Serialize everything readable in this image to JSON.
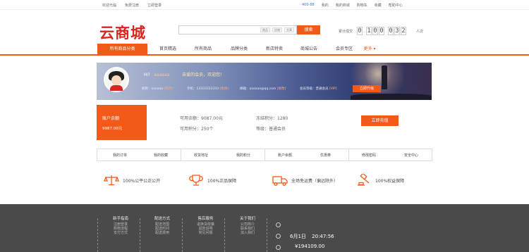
{
  "topbar": {
    "left": [
      "欢迎光临",
      "免费注册",
      "立即登录"
    ],
    "right": [
      "400-88",
      "我的",
      "我的商城",
      "购物车",
      "收藏",
      "帮助中心"
    ]
  },
  "logo": "云商城",
  "search": {
    "tags": [
      "商品",
      "店铺",
      "文章"
    ],
    "button": "搜索"
  },
  "counter": {
    "label": "累计成交",
    "digits": [
      "0",
      "1",
      "0",
      "0",
      "0",
      "3",
      "2"
    ],
    "unit": "人次"
  },
  "nav": {
    "tabs": [
      "所有商品分类",
      "首页精选",
      "所有商品",
      "品牌分类",
      "新店特卖",
      "商城公告",
      "会员专区",
      "更多"
    ],
    "active_index": 0
  },
  "banner": {
    "greeting": "Hi！",
    "username": "aaaaaa",
    "tip": "亲爱的会员，欢迎您！",
    "info": [
      {
        "label": "昵称：",
        "value": "aaaaaa",
        "verify": "[修改]"
      },
      {
        "label": "手机：",
        "value": "13333333333",
        "verify": "[修改]"
      },
      {
        "label": "邮箱：",
        "value": "aaaaaa@qq.com",
        "verify": "[修改]"
      },
      {
        "label": "会员等级：",
        "value": "普通会员",
        "verify": "[VIP]"
      }
    ],
    "vip_button": "立即升级"
  },
  "account": {
    "title": "账户余额",
    "value": "9987.00元",
    "available_balance": "可用余额：9087.00元",
    "available_points": "可用积分：250个",
    "frozen_points": "冻结积分：1280",
    "level": "等级：普通会员",
    "recharge_button": "立即充值"
  },
  "links": [
    [
      "我的订单",
      "我的收藏"
    ],
    [
      "收货地址",
      "我的积分"
    ],
    [
      "账户余额",
      "优惠券"
    ],
    [
      "修改密码",
      "安全中心"
    ]
  ],
  "guarantees": [
    {
      "icon": "scale-icon",
      "text": "100%公平公正公开"
    },
    {
      "icon": "trophy-icon",
      "text": "100%正品保障"
    },
    {
      "icon": "truck-icon",
      "text": "全场免运费（偏远除外）"
    },
    {
      "icon": "gavel-icon",
      "text": "100%权益保障"
    }
  ],
  "footer": {
    "columns": [
      {
        "title": "新手指南",
        "items": [
          "注册登录",
          "购物流程",
          "支付方式"
        ]
      },
      {
        "title": "配送方式",
        "items": [
          "配送范围",
          "配送时间",
          "配送费用"
        ]
      },
      {
        "title": "售后服务",
        "items": [
          "退换货政策",
          "退款说明",
          "常见问题"
        ]
      },
      {
        "title": "关于我们",
        "items": [
          "公司简介",
          "联系我们",
          "加入我们"
        ]
      }
    ],
    "date": "6月1日",
    "time": "20:47:56",
    "amount": "¥194109.00"
  }
}
